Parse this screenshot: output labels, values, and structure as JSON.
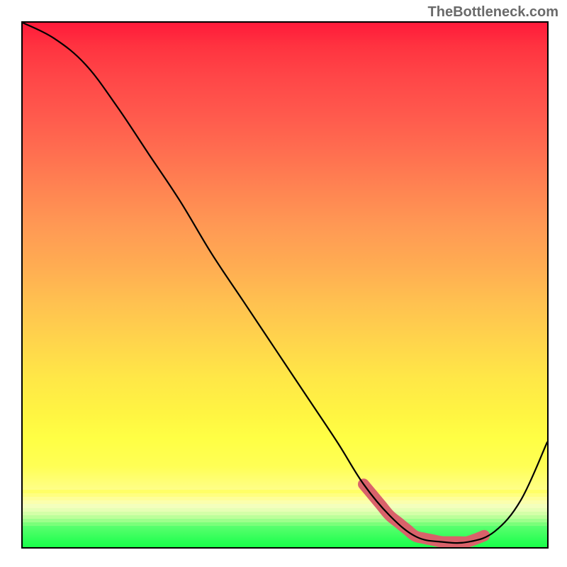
{
  "watermark": "TheBottleneck.com",
  "chart_data": {
    "type": "line",
    "title": "",
    "xlabel": "",
    "ylabel": "",
    "xlim": [
      0,
      100
    ],
    "ylim": [
      0,
      100
    ],
    "series": [
      {
        "name": "curve",
        "x": [
          0,
          6,
          12,
          18,
          24,
          30,
          36,
          42,
          48,
          54,
          60,
          65,
          70,
          75,
          80,
          85,
          90,
          95,
          100
        ],
        "values": [
          100,
          97,
          92,
          84,
          75,
          66,
          56,
          47,
          38,
          29,
          20,
          12,
          6,
          2,
          1,
          1,
          3,
          9,
          20
        ]
      },
      {
        "name": "highlight-band",
        "x": [
          65,
          88
        ],
        "values": [
          3.2,
          3.2
        ]
      }
    ],
    "gradient_stops": [
      {
        "pos": 0,
        "color": "#ff1a3a"
      },
      {
        "pos": 20,
        "color": "#ff5a4d"
      },
      {
        "pos": 40,
        "color": "#ff9a54"
      },
      {
        "pos": 60,
        "color": "#ffc150"
      },
      {
        "pos": 80,
        "color": "#fff542"
      },
      {
        "pos": 90,
        "color": "#ffff55"
      },
      {
        "pos": 94,
        "color": "#f3ff80"
      },
      {
        "pos": 96,
        "color": "#c8ff80"
      },
      {
        "pos": 98,
        "color": "#7aff70"
      },
      {
        "pos": 100,
        "color": "#1aff4a"
      }
    ],
    "transition_stripes": [
      "#ffff66",
      "#ffff80",
      "#feff99",
      "#fbffad",
      "#f3ffbc",
      "#e6ffb5",
      "#d4ffa8",
      "#bcff9a",
      "#9dff8c",
      "#7aff7a"
    ]
  }
}
